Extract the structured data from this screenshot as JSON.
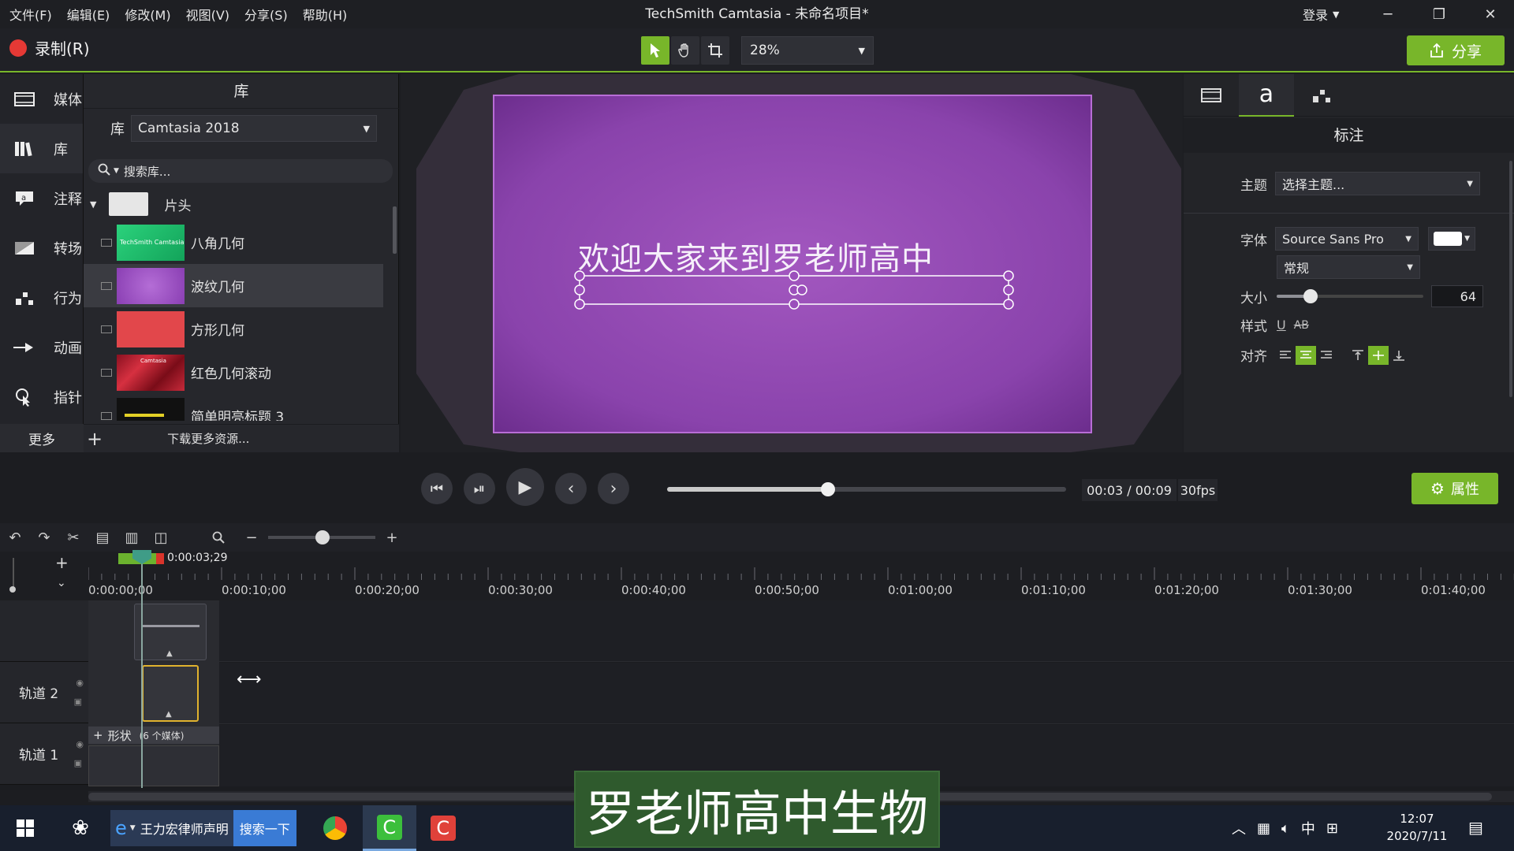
{
  "menu": {
    "items": [
      "文件(F)",
      "编辑(E)",
      "修改(M)",
      "视图(V)",
      "分享(S)",
      "帮助(H)"
    ],
    "window_title": "TechSmith Camtasia - 未命名项目*",
    "login": "登录"
  },
  "toolbar": {
    "record_label": "录制(R)",
    "zoom_value": "28%",
    "share_label": "分享"
  },
  "sidebar": {
    "items": [
      {
        "label": "媒体",
        "icon": "media-icon"
      },
      {
        "label": "库",
        "icon": "library-icon"
      },
      {
        "label": "注释",
        "icon": "annotation-icon"
      },
      {
        "label": "转场",
        "icon": "transition-icon"
      },
      {
        "label": "行为",
        "icon": "behavior-icon"
      },
      {
        "label": "动画",
        "icon": "animation-icon"
      },
      {
        "label": "指针",
        "icon": "cursor-icon"
      }
    ],
    "more_label": "更多"
  },
  "library": {
    "title": "库",
    "lib_label": "库",
    "lib_select": "Camtasia 2018",
    "search_placeholder": "搜索库...",
    "folder_name": "片头",
    "items": [
      {
        "label": "八角几何",
        "thumb_text": "TechSmith Camtasia"
      },
      {
        "label": "波纹几何",
        "thumb_text": ""
      },
      {
        "label": "方形几何",
        "thumb_text": ""
      },
      {
        "label": "红色几何滚动",
        "thumb_text": "Camtasia"
      },
      {
        "label": "简单明亮标题 3",
        "thumb_text": ""
      }
    ],
    "download_more": "下载更多资源..."
  },
  "canvas": {
    "text": "欢迎大家来到罗老师高中"
  },
  "properties": {
    "title": "标注",
    "theme_label": "主题",
    "theme_value": "选择主题...",
    "font_label": "字体",
    "font_value": "Source Sans Pro",
    "weight_value": "常规",
    "size_label": "大小",
    "size_value": "64",
    "size_level": 0.2,
    "style_label": "样式",
    "align_label": "对齐"
  },
  "playback": {
    "time": "00:03 / 00:09",
    "fps": "30fps",
    "position": 0.4,
    "properties_label": "属性"
  },
  "timeline": {
    "playhead_time": "0:00:03;29",
    "ticks": [
      "0:00:00;00",
      "0:00:10;00",
      "0:00:20;00",
      "0:00:30;00",
      "0:00:40;00",
      "0:00:50;00",
      "0:01:00;00",
      "0:01:10;00",
      "0:01:20;00",
      "0:01:30;00",
      "0:01:40;00"
    ],
    "tracks": [
      {
        "label": ""
      },
      {
        "label": "轨道 2"
      },
      {
        "label": "轨道 1"
      }
    ],
    "group_label": "形状",
    "group_count": "(6 个媒体)"
  },
  "taskbar": {
    "ie_text": "王力宏律师声明",
    "search_btn": "搜索一下",
    "ime": "中",
    "time": "12:07",
    "date": "2020/7/11"
  },
  "overlay": {
    "subtitle": "罗老师高中生物"
  },
  "colors": {
    "accent": "#78b62a",
    "canvas": "#9b4fbb",
    "record": "#e53935"
  }
}
